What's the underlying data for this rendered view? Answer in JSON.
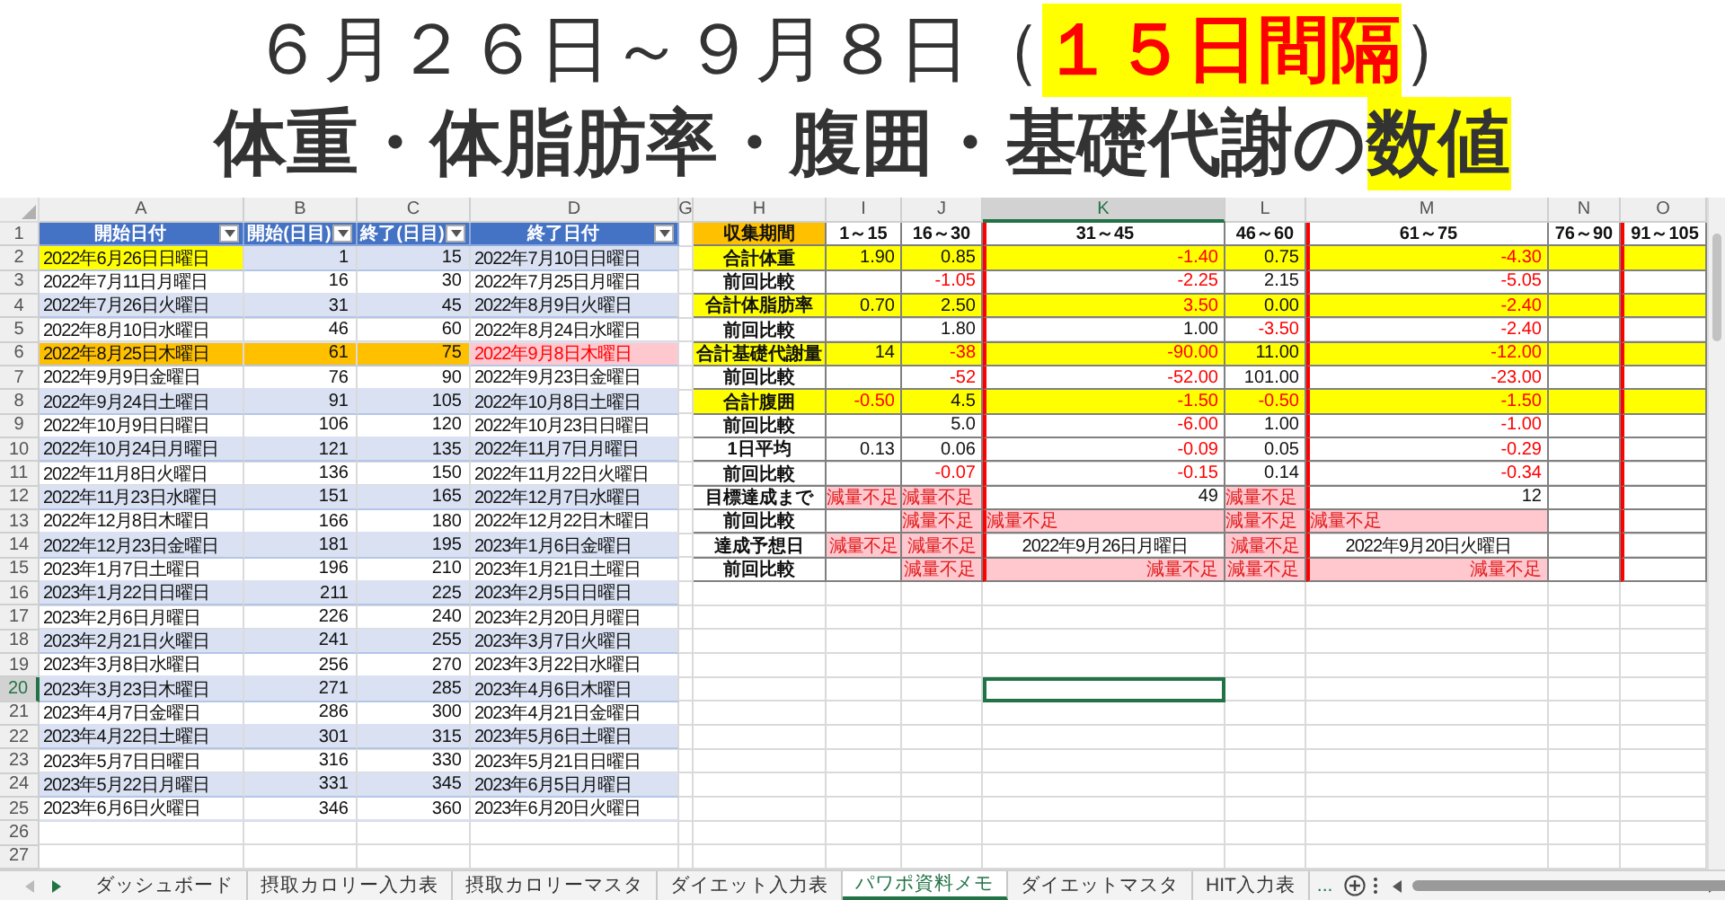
{
  "title": {
    "line1": [
      {
        "text": "６月２６日～９月８日（",
        "emphasis": false
      },
      {
        "text": "１５日間隔",
        "emphasis": true
      },
      {
        "text": "）",
        "emphasis": false
      }
    ],
    "line2": [
      {
        "text": "体重・体脂肪率・腹囲・基礎代謝の",
        "highlight": false
      },
      {
        "text": "数値",
        "highlight": true
      }
    ]
  },
  "columns": [
    {
      "label": "A",
      "selected": false
    },
    {
      "label": "B",
      "selected": false
    },
    {
      "label": "C",
      "selected": false
    },
    {
      "label": "D",
      "selected": false
    },
    {
      "label": "G",
      "selected": false
    },
    {
      "label": "H",
      "selected": false
    },
    {
      "label": "I",
      "selected": false
    },
    {
      "label": "J",
      "selected": false
    },
    {
      "label": "K",
      "selected": true
    },
    {
      "label": "L",
      "selected": false
    },
    {
      "label": "M",
      "selected": false
    },
    {
      "label": "N",
      "selected": false
    },
    {
      "label": "O",
      "selected": false
    }
  ],
  "rows": [
    {
      "label": "1",
      "selected": false
    },
    {
      "label": "2",
      "selected": false
    },
    {
      "label": "3",
      "selected": false
    },
    {
      "label": "4",
      "selected": false
    },
    {
      "label": "5",
      "selected": false
    },
    {
      "label": "6",
      "selected": false
    },
    {
      "label": "7",
      "selected": false
    },
    {
      "label": "8",
      "selected": false
    },
    {
      "label": "9",
      "selected": false
    },
    {
      "label": "10",
      "selected": false
    },
    {
      "label": "11",
      "selected": false
    },
    {
      "label": "12",
      "selected": false
    },
    {
      "label": "13",
      "selected": false
    },
    {
      "label": "14",
      "selected": false
    },
    {
      "label": "15",
      "selected": false
    },
    {
      "label": "16",
      "selected": false
    },
    {
      "label": "17",
      "selected": false
    },
    {
      "label": "18",
      "selected": false
    },
    {
      "label": "19",
      "selected": false
    },
    {
      "label": "20",
      "selected": true
    },
    {
      "label": "21",
      "selected": false
    },
    {
      "label": "22",
      "selected": false
    },
    {
      "label": "23",
      "selected": false
    },
    {
      "label": "24",
      "selected": false
    },
    {
      "label": "25",
      "selected": false
    },
    {
      "label": "26",
      "selected": false
    },
    {
      "label": "27",
      "selected": false
    }
  ],
  "schedule": {
    "headers": [
      "開始日付",
      "開始(日目)",
      "終了(日目)",
      "終了日付"
    ],
    "rows": [
      {
        "start_date": "2022年6月26日日曜日",
        "start_day": "1",
        "end_day": "15",
        "end_date": "2022年7月10日日曜日",
        "kind": "first"
      },
      {
        "start_date": "2022年7月11日月曜日",
        "start_day": "16",
        "end_day": "30",
        "end_date": "2022年7月25日月曜日",
        "kind": "normal"
      },
      {
        "start_date": "2022年7月26日火曜日",
        "start_day": "31",
        "end_day": "45",
        "end_date": "2022年8月9日火曜日",
        "kind": "normal"
      },
      {
        "start_date": "2022年8月10日水曜日",
        "start_day": "46",
        "end_day": "60",
        "end_date": "2022年8月24日水曜日",
        "kind": "normal"
      },
      {
        "start_date": "2022年8月25日木曜日",
        "start_day": "61",
        "end_day": "75",
        "end_date": "2022年9月8日木曜日",
        "kind": "current"
      },
      {
        "start_date": "2022年9月9日金曜日",
        "start_day": "76",
        "end_day": "90",
        "end_date": "2022年9月23日金曜日",
        "kind": "normal"
      },
      {
        "start_date": "2022年9月24日土曜日",
        "start_day": "91",
        "end_day": "105",
        "end_date": "2022年10月8日土曜日",
        "kind": "normal"
      },
      {
        "start_date": "2022年10月9日日曜日",
        "start_day": "106",
        "end_day": "120",
        "end_date": "2022年10月23日日曜日",
        "kind": "normal"
      },
      {
        "start_date": "2022年10月24日月曜日",
        "start_day": "121",
        "end_day": "135",
        "end_date": "2022年11月7日月曜日",
        "kind": "normal"
      },
      {
        "start_date": "2022年11月8日火曜日",
        "start_day": "136",
        "end_day": "150",
        "end_date": "2022年11月22日火曜日",
        "kind": "normal"
      },
      {
        "start_date": "2022年11月23日水曜日",
        "start_day": "151",
        "end_day": "165",
        "end_date": "2022年12月7日水曜日",
        "kind": "normal"
      },
      {
        "start_date": "2022年12月8日木曜日",
        "start_day": "166",
        "end_day": "180",
        "end_date": "2022年12月22日木曜日",
        "kind": "normal"
      },
      {
        "start_date": "2022年12月23日金曜日",
        "start_day": "181",
        "end_day": "195",
        "end_date": "2023年1月6日金曜日",
        "kind": "normal"
      },
      {
        "start_date": "2023年1月7日土曜日",
        "start_day": "196",
        "end_day": "210",
        "end_date": "2023年1月21日土曜日",
        "kind": "normal"
      },
      {
        "start_date": "2023年1月22日日曜日",
        "start_day": "211",
        "end_day": "225",
        "end_date": "2023年2月5日日曜日",
        "kind": "normal"
      },
      {
        "start_date": "2023年2月6日月曜日",
        "start_day": "226",
        "end_day": "240",
        "end_date": "2023年2月20日月曜日",
        "kind": "normal"
      },
      {
        "start_date": "2023年2月21日火曜日",
        "start_day": "241",
        "end_day": "255",
        "end_date": "2023年3月7日火曜日",
        "kind": "normal"
      },
      {
        "start_date": "2023年3月8日水曜日",
        "start_day": "256",
        "end_day": "270",
        "end_date": "2023年3月22日水曜日",
        "kind": "normal"
      },
      {
        "start_date": "2023年3月23日木曜日",
        "start_day": "271",
        "end_day": "285",
        "end_date": "2023年4月6日木曜日",
        "kind": "normal"
      },
      {
        "start_date": "2023年4月7日金曜日",
        "start_day": "286",
        "end_day": "300",
        "end_date": "2023年4月21日金曜日",
        "kind": "normal"
      },
      {
        "start_date": "2023年4月22日土曜日",
        "start_day": "301",
        "end_day": "315",
        "end_date": "2023年5月6日土曜日",
        "kind": "normal"
      },
      {
        "start_date": "2023年5月7日日曜日",
        "start_day": "316",
        "end_day": "330",
        "end_date": "2023年5月21日日曜日",
        "kind": "normal"
      },
      {
        "start_date": "2023年5月22日月曜日",
        "start_day": "331",
        "end_day": "345",
        "end_date": "2023年6月5日月曜日",
        "kind": "normal"
      },
      {
        "start_date": "2023年6月6日火曜日",
        "start_day": "346",
        "end_day": "360",
        "end_date": "2023年6月20日火曜日",
        "kind": "normal"
      }
    ]
  },
  "summary": {
    "header": "収集期間",
    "periods": [
      {
        "label": "1～15",
        "divider": false
      },
      {
        "label": "16～30",
        "divider": false
      },
      {
        "label": "31～45",
        "divider": true
      },
      {
        "label": "46～60",
        "divider": false
      },
      {
        "label": "61～75",
        "divider": true
      },
      {
        "label": "76～90",
        "divider": false
      },
      {
        "label": "91～105",
        "divider": true
      }
    ],
    "rows": [
      {
        "label": "合計体重",
        "kind": "total",
        "cells": [
          {
            "text": "1.90",
            "red": false
          },
          {
            "text": "0.85",
            "red": false
          },
          {
            "text": "-1.40",
            "red": true
          },
          {
            "text": "0.75",
            "red": false
          },
          {
            "text": "-4.30",
            "red": true
          }
        ]
      },
      {
        "label": "前回比較",
        "kind": "compare",
        "cells": [
          null,
          {
            "text": "-1.05",
            "red": true
          },
          {
            "text": "-2.25",
            "red": true
          },
          {
            "text": "2.15",
            "red": false
          },
          {
            "text": "-5.05",
            "red": true
          }
        ]
      },
      {
        "label": "合計体脂肪率",
        "kind": "total",
        "cells": [
          {
            "text": "0.70",
            "red": false
          },
          {
            "text": "2.50",
            "red": false
          },
          {
            "text": "3.50",
            "red": true
          },
          {
            "text": "0.00",
            "red": false
          },
          {
            "text": "-2.40",
            "red": true
          }
        ]
      },
      {
        "label": "前回比較",
        "kind": "compare",
        "cells": [
          null,
          {
            "text": "1.80",
            "red": false
          },
          {
            "text": "1.00",
            "red": false
          },
          {
            "text": "-3.50",
            "red": true
          },
          {
            "text": "-2.40",
            "red": true
          }
        ]
      },
      {
        "label": "合計基礎代謝量",
        "kind": "total",
        "cells": [
          {
            "text": "14",
            "red": false
          },
          {
            "text": "-38",
            "red": true
          },
          {
            "text": "-90.00",
            "red": true
          },
          {
            "text": "11.00",
            "red": false
          },
          {
            "text": "-12.00",
            "red": true
          }
        ]
      },
      {
        "label": "前回比較",
        "kind": "compare",
        "cells": [
          null,
          {
            "text": "-52",
            "red": true
          },
          {
            "text": "-52.00",
            "red": true
          },
          {
            "text": "101.00",
            "red": false
          },
          {
            "text": "-23.00",
            "red": true
          }
        ]
      },
      {
        "label": "合計腹囲",
        "kind": "total",
        "cells": [
          {
            "text": "-0.50",
            "red": true
          },
          {
            "text": "4.5",
            "red": false
          },
          {
            "text": "-1.50",
            "red": true
          },
          {
            "text": "-0.50",
            "red": true
          },
          {
            "text": "-1.50",
            "red": true
          }
        ]
      },
      {
        "label": "前回比較",
        "kind": "compare",
        "cells": [
          null,
          {
            "text": "5.0",
            "red": false
          },
          {
            "text": "-6.00",
            "red": true
          },
          {
            "text": "1.00",
            "red": false
          },
          {
            "text": "-1.00",
            "red": true
          }
        ]
      },
      {
        "label": "1日平均",
        "kind": "compare",
        "cells": [
          {
            "text": "0.13",
            "red": false
          },
          {
            "text": "0.06",
            "red": false
          },
          {
            "text": "-0.09",
            "red": true
          },
          {
            "text": "0.05",
            "red": false
          },
          {
            "text": "-0.29",
            "red": true
          }
        ]
      },
      {
        "label": "前回比較",
        "kind": "compare",
        "cells": [
          null,
          {
            "text": "-0.07",
            "red": true
          },
          {
            "text": "-0.15",
            "red": true
          },
          {
            "text": "0.14",
            "red": false
          },
          {
            "text": "-0.34",
            "red": true
          }
        ]
      },
      {
        "label": "目標達成まで",
        "kind": "status",
        "cells": [
          {
            "text": "減量不足",
            "alert": true
          },
          {
            "text": "減量不足",
            "alert": true
          },
          {
            "text": "49",
            "alert": false
          },
          {
            "text": "減量不足",
            "alert": true
          },
          {
            "text": "12",
            "alert": false
          }
        ]
      },
      {
        "label": "前回比較",
        "kind": "status",
        "cells": [
          null,
          {
            "text": "減量不足",
            "alert": true
          },
          {
            "text": "減量不足",
            "alert": true
          },
          {
            "text": "減量不足",
            "alert": true
          },
          {
            "text": "減量不足",
            "alert": true
          }
        ]
      },
      {
        "label": "達成予想日",
        "kind": "date",
        "cells": [
          {
            "text": "減量不足",
            "alert": true
          },
          {
            "text": "減量不足",
            "alert": true
          },
          {
            "text": "2022年9月26日月曜日",
            "alert": false
          },
          {
            "text": "減量不足",
            "alert": true
          },
          {
            "text": "2022年9月20日火曜日",
            "alert": false
          }
        ]
      },
      {
        "label": "前回比較",
        "kind": "compare",
        "cells": [
          null,
          {
            "text": "減量不足",
            "alert": true
          },
          {
            "text": "減量不足",
            "alert": true
          },
          {
            "text": "減量不足",
            "alert": true
          },
          {
            "text": "減量不足",
            "alert": true
          }
        ]
      }
    ]
  },
  "tabs": [
    {
      "label": "ダッシュボード",
      "selected": false
    },
    {
      "label": "摂取カロリー入力表",
      "selected": false
    },
    {
      "label": "摂取カロリーマスタ",
      "selected": false
    },
    {
      "label": "ダイエット入力表",
      "selected": false
    },
    {
      "label": "パワポ資料メモ",
      "selected": true
    },
    {
      "label": "ダイエットマスタ",
      "selected": false
    },
    {
      "label": "HIT入力表",
      "selected": false
    }
  ],
  "more_tabs": "..."
}
